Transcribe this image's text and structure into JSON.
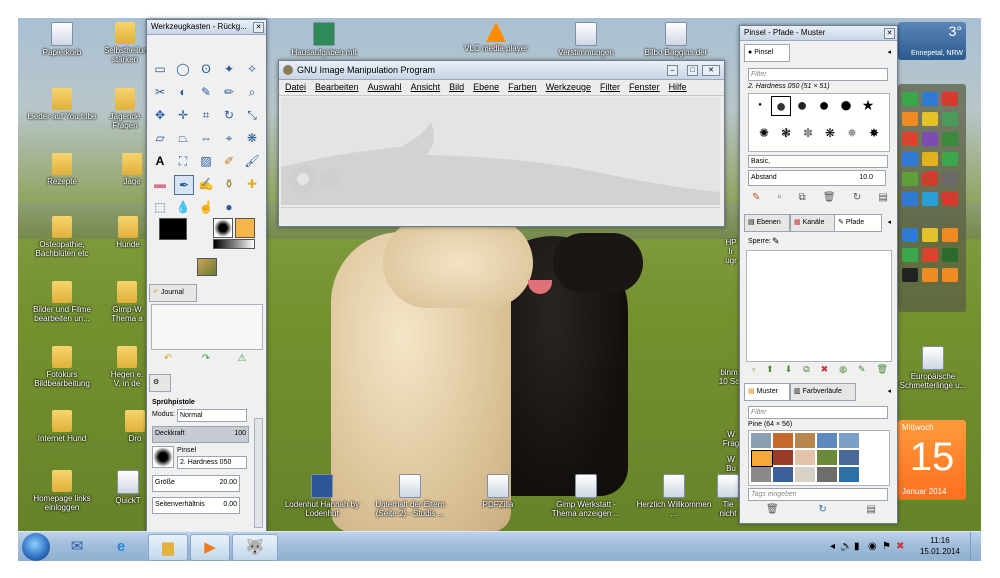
{
  "desktop_icons": [
    {
      "label": "Papierkorb",
      "glyph": "🗑"
    },
    {
      "label": "Lieder auf You tube",
      "glyph": ""
    },
    {
      "label": "Rezepte",
      "glyph": ""
    },
    {
      "label": "Osteopathie, Bachblüten etc",
      "glyph": ""
    },
    {
      "label": "Bilder und Filme bearbeiten un...",
      "glyph": ""
    },
    {
      "label": "Fotokurs Bildbearbeitung",
      "glyph": ""
    },
    {
      "label": "Internet Hund",
      "glyph": ""
    },
    {
      "label": "Homepage links einloggen",
      "glyph": ""
    },
    {
      "label": "Selbstheilungskräfte stärken",
      "glyph": ""
    },
    {
      "label": "Jagende Fragen",
      "glyph": ""
    },
    {
      "label": "Jage",
      "glyph": ""
    },
    {
      "label": "Hunde",
      "glyph": ""
    },
    {
      "label": "Gimp-W Thema a",
      "glyph": ""
    },
    {
      "label": "Hegen e. V. in de",
      "glyph": ""
    },
    {
      "label": "Dro",
      "glyph": ""
    },
    {
      "label": "QuickT",
      "glyph": ""
    },
    {
      "label": "Hausaufgaben mit",
      "glyph": "▣"
    },
    {
      "label": "VLC media player",
      "glyph": "▲"
    },
    {
      "label": "Verstimmungen",
      "glyph": "⇱"
    },
    {
      "label": "Bilbo Baggins der",
      "glyph": "⇱"
    },
    {
      "label": "Lodenhut Hannah by Lodenhut",
      "glyph": "W"
    },
    {
      "label": "Unterhalt der Eltern (Seite 2) - Studis ...",
      "glyph": "⇱"
    },
    {
      "label": "PDFZilla",
      "glyph": "⇱"
    },
    {
      "label": "Gimp Werkstatt - Thema anzeigen ...",
      "glyph": "⇱"
    },
    {
      "label": "Herzlich Willkommen ...",
      "glyph": "⇱"
    },
    {
      "label": "Tie nicht",
      "glyph": ""
    },
    {
      "label": "HP Ir ugr",
      "glyph": ""
    },
    {
      "label": "binm 10 Sc",
      "glyph": ""
    },
    {
      "label": "W Frag",
      "glyph": ""
    },
    {
      "label": "W Bu",
      "glyph": ""
    },
    {
      "label": "Europäische Schmetterlinge u...",
      "glyph": "⇱"
    }
  ],
  "weather": {
    "temp": "3°",
    "city": "Ennepetal, NRW"
  },
  "calendar": {
    "weekday": "Mittwoch",
    "day": "15",
    "month_year": "Januar 2014"
  },
  "toolbox": {
    "title": "Werkzeugkasten - Rückg...",
    "tab_journal": "Journal",
    "tool_options_title": "Sprühpistole",
    "mode_label": "Modus:",
    "mode_value": "Normal",
    "opacity_label": "Deckkraft",
    "opacity_value": "100",
    "brush_label": "Pinsel",
    "brush_value": "2. Hardness 050",
    "size_label": "Größe",
    "size_value": "20.00",
    "aspect_label": "Seitenverhältnis",
    "aspect_value": "0.00"
  },
  "gimp": {
    "title": "GNU Image Manipulation Program",
    "menu": [
      "Datei",
      "Bearbeiten",
      "Auswahl",
      "Ansicht",
      "Bild",
      "Ebene",
      "Farben",
      "Werkzeuge",
      "Filter",
      "Fenster",
      "Hilfe"
    ]
  },
  "dock": {
    "title": "Pinsel - Pfade - Muster",
    "tab_brushes": "Pinsel",
    "filter_placeholder": "Filter",
    "brush_name": "2. Hardness 050 (51 × 51)",
    "tag_value": "Basic,",
    "spacing_label": "Abstand",
    "spacing_value": "10.0",
    "tabs_mid": [
      "Ebenen",
      "Kanäle",
      "Pfade"
    ],
    "lock_label": "Sperre:",
    "tabs_bottom": [
      "Muster",
      "Farbverläufe"
    ],
    "pattern_name": "Pine (64 × 56)",
    "tags_placeholder": "Tags eingeben"
  },
  "clock": {
    "time": "11:16",
    "date": "15.01.2014"
  },
  "colors": {
    "accent": "#ff7f27",
    "taskbar": "#9fbbd9"
  }
}
